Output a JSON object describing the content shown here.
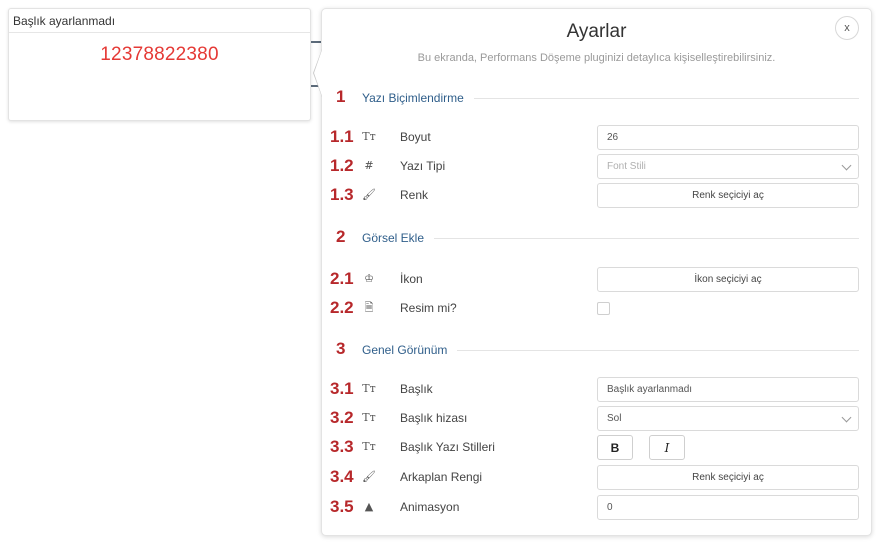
{
  "widget": {
    "header": "Başlık ayarlanmadı",
    "value": "12378822380"
  },
  "panel": {
    "title": "Ayarlar",
    "subtitle": "Bu ekranda, Performans Döşeme pluginizi detaylıca kişiselleştirebilirsiniz.",
    "close_label": "x"
  },
  "sections": [
    {
      "number": "1",
      "title": "Yazı Biçimlendirme",
      "rows": [
        {
          "number": "1.1",
          "icon": "text-size-icon",
          "icon_glyph": "Tт",
          "label": "Boyut",
          "control": "input",
          "value": "26"
        },
        {
          "number": "1.2",
          "icon": "hash-icon",
          "icon_glyph": "#",
          "label": "Yazı Tipi",
          "control": "select",
          "placeholder": "Font Stili"
        },
        {
          "number": "1.3",
          "icon": "paint-bucket-icon",
          "icon_glyph": "🖌",
          "label": "Renk",
          "control": "button",
          "button_label": "Renk seçiciyi aç"
        }
      ]
    },
    {
      "number": "2",
      "title": "Görsel Ekle",
      "rows": [
        {
          "number": "2.1",
          "icon": "icon-picker-icon",
          "icon_glyph": "♔",
          "label": "İkon",
          "control": "button",
          "button_label": "İkon seçiciyi aç"
        },
        {
          "number": "2.2",
          "icon": "file-image-icon",
          "icon_glyph": "🗎",
          "label": "Resim mi?",
          "control": "checkbox",
          "checked": false
        }
      ]
    },
    {
      "number": "3",
      "title": "Genel Görünüm",
      "rows": [
        {
          "number": "3.1",
          "icon": "text-size-icon",
          "icon_glyph": "Tт",
          "label": "Başlık",
          "control": "input",
          "value": "Başlık ayarlanmadı"
        },
        {
          "number": "3.2",
          "icon": "text-size-icon",
          "icon_glyph": "Tт",
          "label": "Başlık hizası",
          "control": "select",
          "value": "Sol"
        },
        {
          "number": "3.3",
          "icon": "text-size-icon",
          "icon_glyph": "Tт",
          "label": "Başlık Yazı Stilleri",
          "control": "styles",
          "bold_label": "B",
          "italic_label": "I"
        },
        {
          "number": "3.4",
          "icon": "paint-bucket-icon",
          "icon_glyph": "🖌",
          "label": "Arkaplan Rengi",
          "control": "button",
          "button_label": "Renk seçiciyi aç"
        },
        {
          "number": "3.5",
          "icon": "animation-icon",
          "icon_glyph": "▲",
          "label": "Animasyon",
          "control": "input",
          "value": "0"
        }
      ]
    }
  ],
  "colors": {
    "accent_red": "#b7282b",
    "value_red": "#e53935",
    "section_title_blue": "#2f5e8a"
  }
}
